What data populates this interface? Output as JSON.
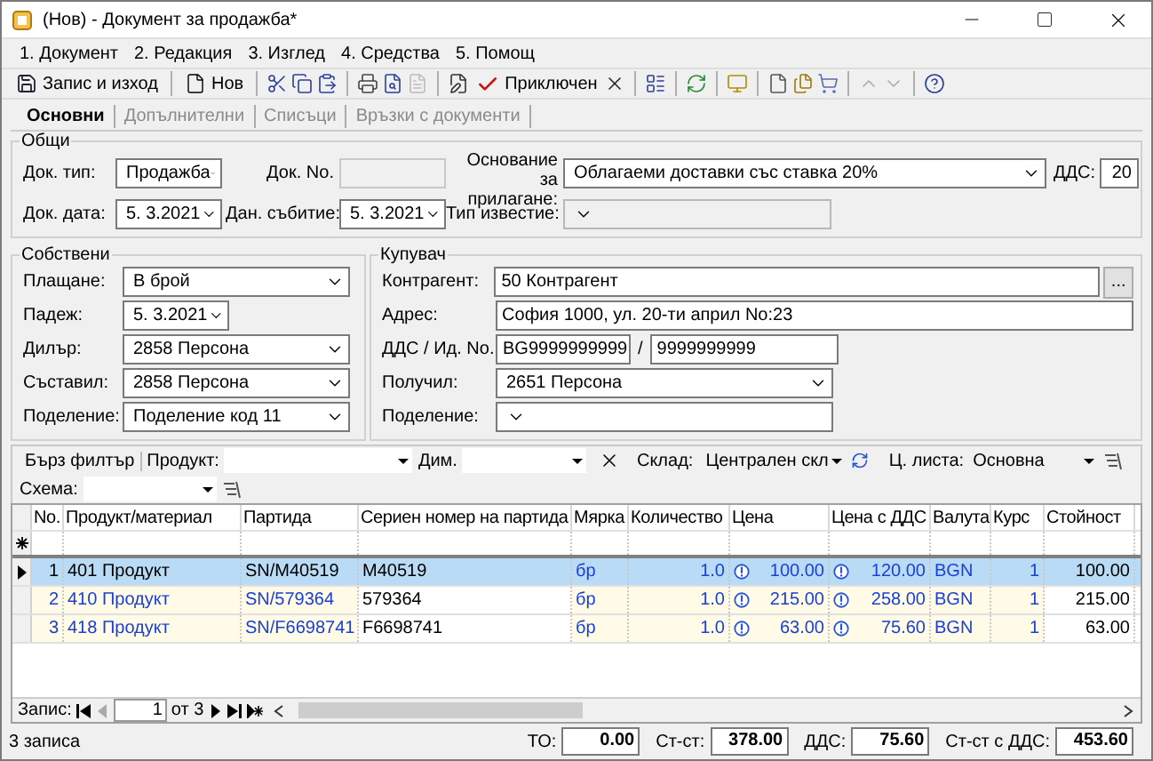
{
  "window": {
    "title": "(Нов) - Документ за продажба*"
  },
  "menu": [
    "1. Документ",
    "2. Редакция",
    "3. Изглед",
    "4. Средства",
    "5. Помощ"
  ],
  "toolbar": [
    {
      "label": "Запис и изход"
    },
    {
      "label": "Нов"
    },
    {
      "label": "Приключен"
    }
  ],
  "tabs": [
    {
      "label": "Основни",
      "selected": true
    },
    {
      "label": "Допълнителни",
      "selected": false
    },
    {
      "label": "Списъци",
      "selected": false
    },
    {
      "label": "Връзки с документи",
      "selected": false
    }
  ],
  "general": {
    "title": "Общи",
    "doc_type": {
      "label": "Док. тип:",
      "value": "Продажба"
    },
    "doc_no": {
      "label": "Док. No.",
      "disabled": true
    },
    "basis": {
      "label": "Основание за прилагане:",
      "value": "Облагаеми доставки със ставка 20%"
    },
    "vat": {
      "label": "ДДС:",
      "value": "20"
    },
    "doc_date": {
      "label": "Док. дата:",
      "value": "5.  3.2021"
    },
    "tax_event": {
      "label": "Дан. събитие:",
      "value": "5.  3.2021"
    },
    "notice_type": {
      "label": "Тип известие:",
      "disabled": true
    }
  },
  "own": {
    "title": "Собствени",
    "fields": [
      {
        "kind": "combo",
        "label": "Плащане:",
        "value": "В брой"
      },
      {
        "kind": "date",
        "label": "Падеж:",
        "value": "5.  3.2021"
      },
      {
        "kind": "combo",
        "label": "Дилър:",
        "value": "2858 Персона"
      },
      {
        "kind": "combo",
        "label": "Съставил:",
        "value": "2858 Персона"
      },
      {
        "kind": "combo",
        "label": "Поделение:",
        "value": "Поделение код 11"
      }
    ]
  },
  "buyer": {
    "title": "Купувач",
    "fields": [
      {
        "kind": "lookup",
        "label": "Контрагент:",
        "value": "50 Контрагент",
        "button": "..."
      },
      {
        "kind": "text",
        "label": "Адрес:",
        "value": "София 1000, ул. 20-ти април No:23"
      },
      {
        "kind": "pair",
        "label": "ДДС / Ид. No.",
        "value": "BG9999999999",
        "separator": "/",
        "value2": "9999999999"
      },
      {
        "kind": "combo",
        "label": "Получил:",
        "value": "2651 Персона"
      },
      {
        "kind": "combo",
        "label": "Поделение:"
      }
    ]
  },
  "filter": {
    "quick_filter": "Бърз филтър",
    "product": "Продукт:",
    "dim": "Дим.",
    "warehouse_label": "Склад:",
    "warehouse": "Централен скл",
    "price_list_label": "Ц. листа:",
    "price_list": "Основна",
    "scheme": "Схема:"
  },
  "table": {
    "columns": [
      "No.",
      "Продукт/материал",
      "Партида",
      "Сериен номер на партида",
      "Мярка",
      "Количество",
      "Цена",
      "Цена с ДДС",
      "Валута",
      "Курс",
      "Стойност"
    ],
    "rows": [
      {
        "selected": true,
        "cells": [
          "1",
          "401 Продукт",
          "SN/M40519",
          "M40519",
          "бр",
          "1.0",
          "100.00",
          "120.00",
          "BGN",
          "1",
          "100.00"
        ]
      },
      {
        "selected": false,
        "cells": [
          "2",
          "410 Продукт",
          "SN/579364",
          "579364",
          "бр",
          "1.0",
          "215.00",
          "258.00",
          "BGN",
          "1",
          "215.00"
        ]
      },
      {
        "selected": false,
        "cells": [
          "3",
          "418 Продукт",
          "SN/F6698741",
          "F6698741",
          "бр",
          "1.0",
          "63.00",
          "75.60",
          "BGN",
          "1",
          "63.00"
        ]
      }
    ]
  },
  "navigator": {
    "label": "Запис:",
    "current": "1",
    "of": "от 3"
  },
  "status": {
    "records": "3 записа",
    "totals": [
      {
        "label": "ТО:",
        "value": "0.00"
      },
      {
        "label": "Ст-ст:",
        "value": "378.00"
      },
      {
        "label": "ДДС:",
        "value": "75.60"
      },
      {
        "label": "Ст-ст с ДДС:",
        "value": "453.60"
      }
    ]
  }
}
